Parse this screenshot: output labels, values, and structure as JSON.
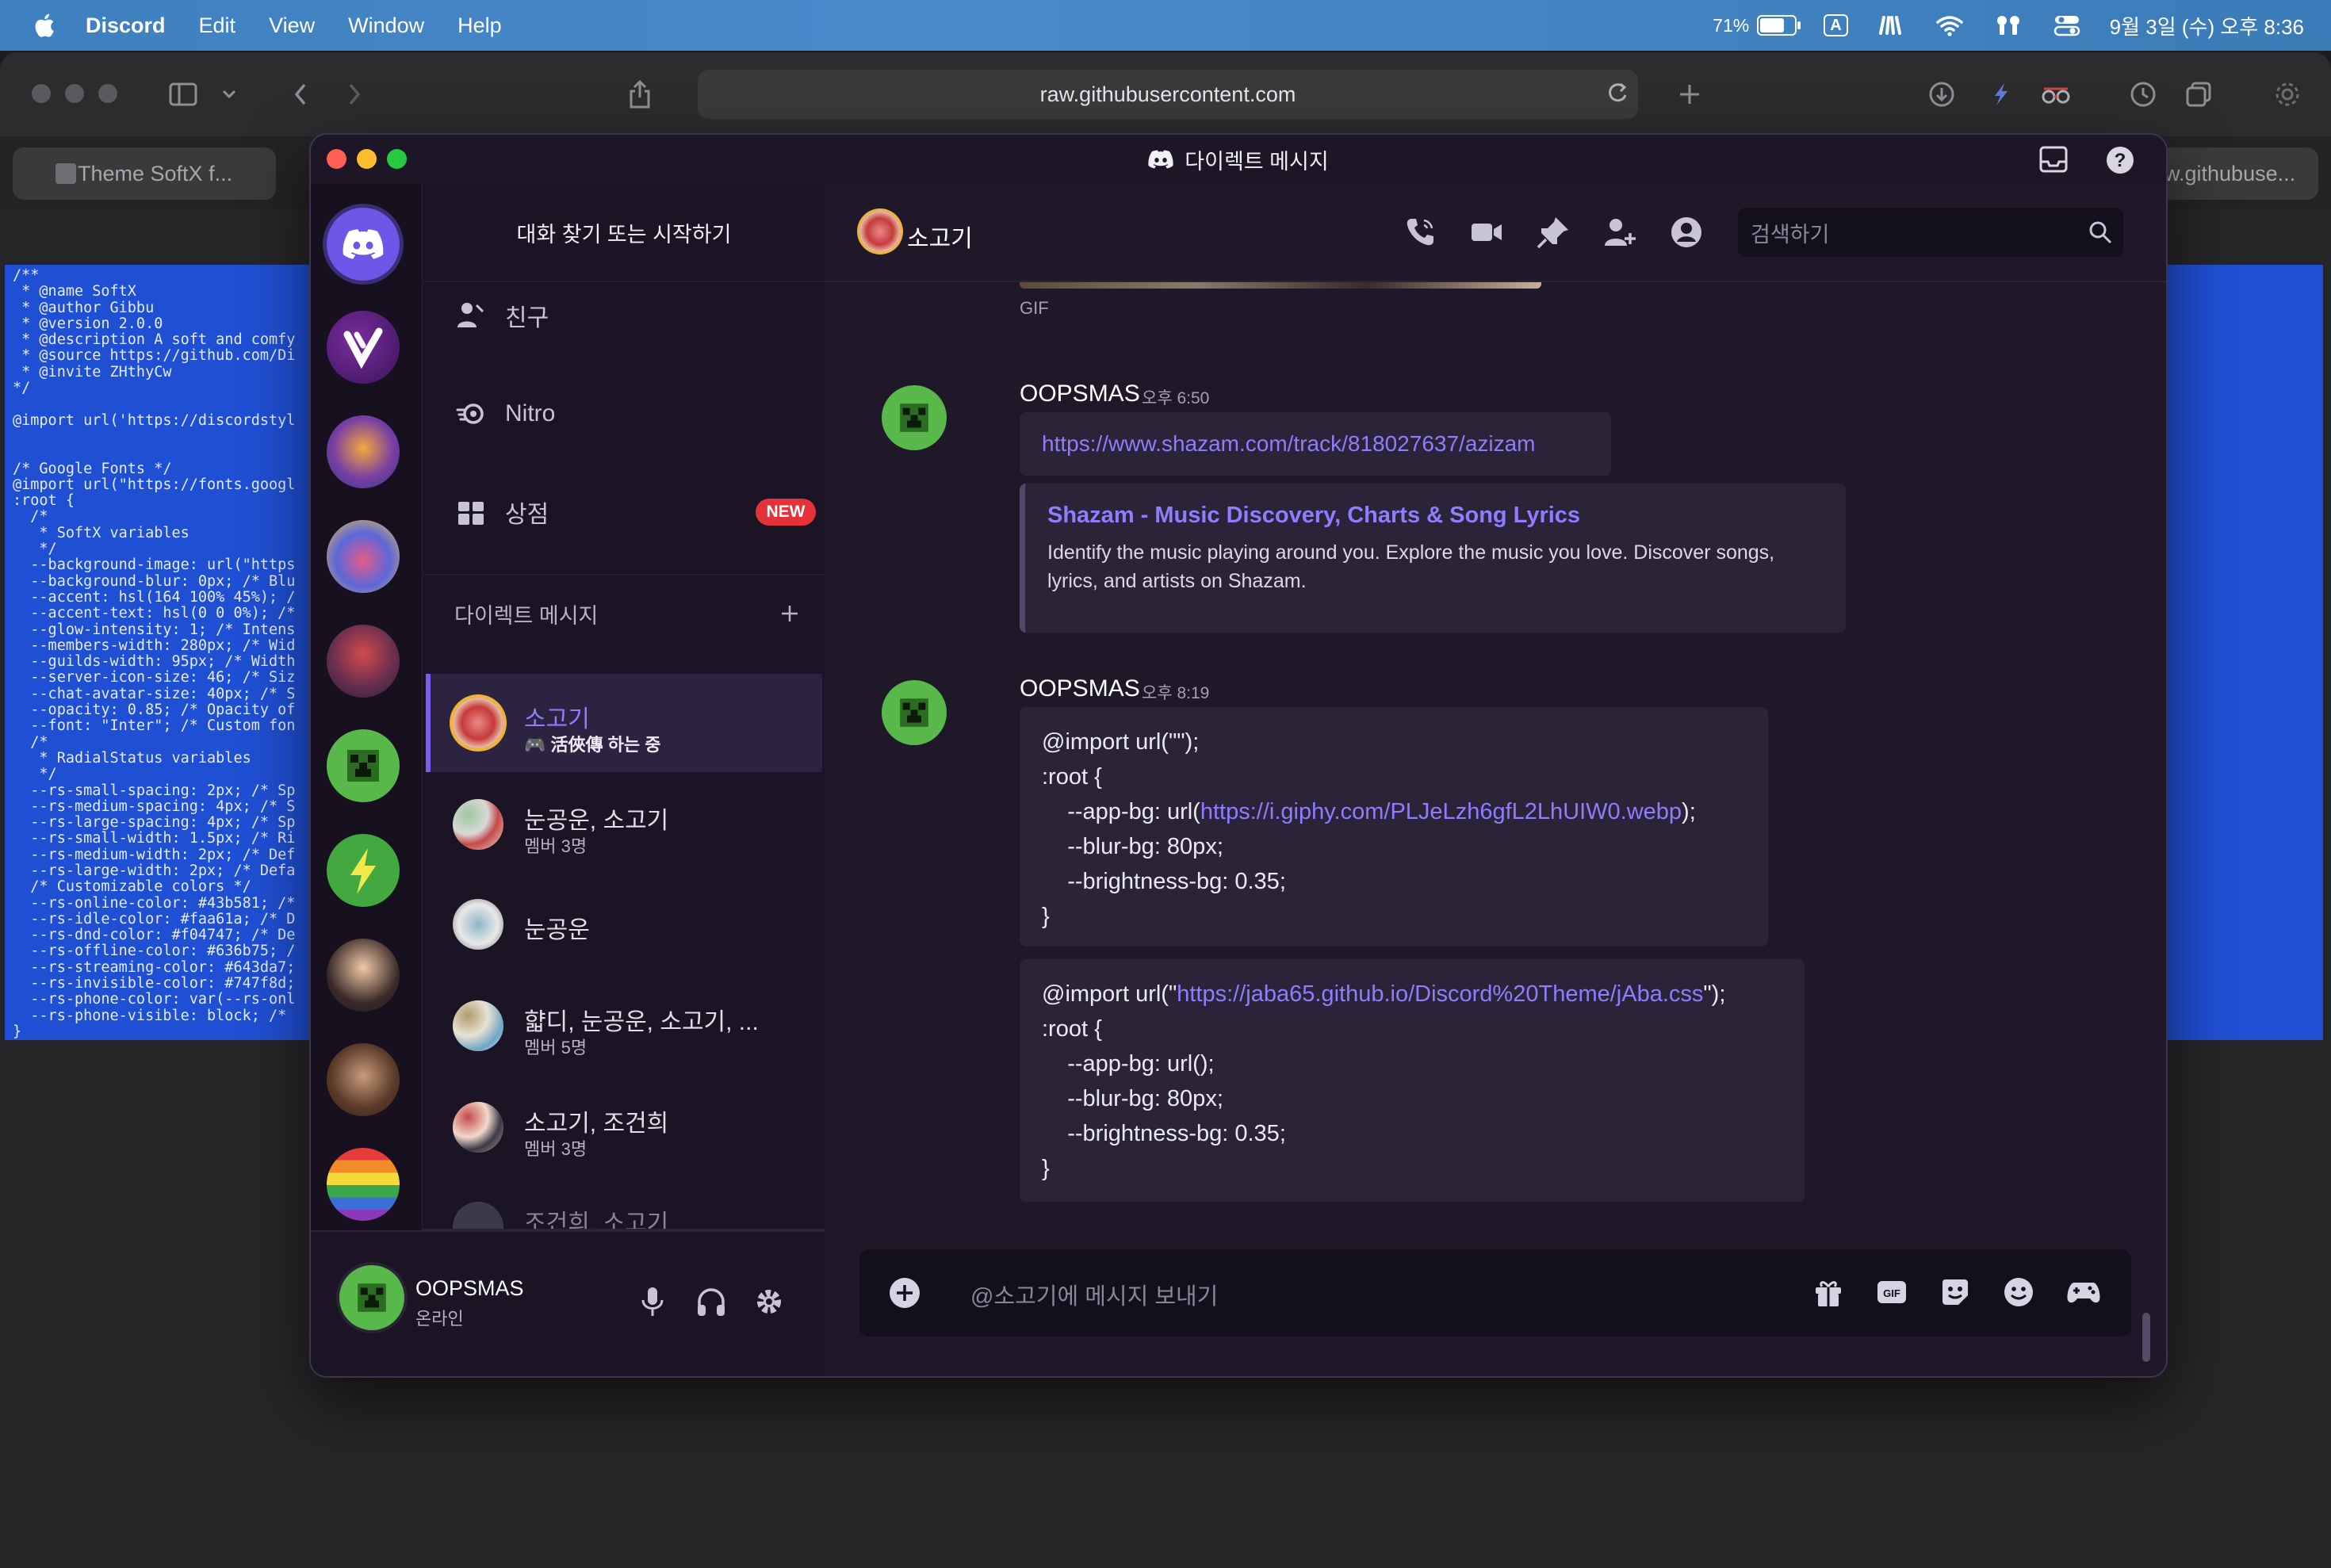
{
  "menubar": {
    "app_name": "Discord",
    "items": [
      "Edit",
      "View",
      "Window",
      "Help"
    ],
    "battery_pct": "71%",
    "battery_level": 0.71,
    "input_indicator": "A",
    "clock": "9월 3일 (수) 오후 8:36"
  },
  "safari": {
    "url": "raw.githubusercontent.com",
    "tab_left": "Theme SoftX f...",
    "tab_right": "w.githubuse...",
    "code_text": "/**\n * @name SoftX\n * @author Gibbu\n * @version 2.0.0\n * @description A soft and comfy\n * @source https://github.com/Di\n * @invite ZHthyCw\n*/\n\n@import url('https://discordstyl\n\n\n/* Google Fonts */\n@import url(\"https://fonts.googl\n:root {\n  /*\n   * SoftX variables\n   */\n  --background-image: url(\"https\n  --background-blur: 0px; /* Blu\n  --accent: hsl(164 100% 45%); /\n  --accent-text: hsl(0 0 0%); /*\n  --glow-intensity: 1; /* Intens\n  --members-width: 280px; /* Wid\n  --guilds-width: 95px; /* Width\n  --server-icon-size: 46; /* Siz\n  --chat-avatar-size: 40px; /* S\n  --opacity: 0.85; /* Opacity of\n  --font: \"Inter\"; /* Custom fon\n  /*\n   * RadialStatus variables\n   */\n  --rs-small-spacing: 2px; /* Sp\n  --rs-medium-spacing: 4px; /* S\n  --rs-large-spacing: 4px; /* Sp\n  --rs-small-width: 1.5px; /* Ri\n  --rs-medium-width: 2px; /* Def\n  --rs-large-width: 2px; /* Defa\n  /* Customizable colors */\n  --rs-online-color: #43b581; /*\n  --rs-idle-color: #faa61a; /* D\n  --rs-dnd-color: #f04747; /* De\n  --rs-offline-color: #636b75; /\n  --rs-streaming-color: #643da7;\n  --rs-invisible-color: #747f8d;\n  --rs-phone-color: var(--rs-onl\n  --rs-phone-visible: block; /* \n}"
  },
  "discord": {
    "window_title": "다이렉트 메시지",
    "sidebar": {
      "find_button": "대화 찾기 또는 시작하기",
      "nav": [
        {
          "label": "친구"
        },
        {
          "label": "Nitro"
        },
        {
          "label": "상점",
          "badge": "NEW"
        }
      ],
      "dm_header": "다이렉트 메시지",
      "dms": [
        {
          "name": "소고기",
          "sub": "活俠傳 하는 중"
        },
        {
          "name": "눈공운, 소고기",
          "sub": "멤버 3명"
        },
        {
          "name": "눈공운",
          "sub": ""
        },
        {
          "name": "햛디, 눈공운, 소고기, ...",
          "sub": "멤버 5명"
        },
        {
          "name": "소고기, 조건희",
          "sub": "멤버 3명"
        },
        {
          "name": "조건희, 소고기",
          "sub": ""
        }
      ]
    },
    "user": {
      "name": "OOPSMAS",
      "status": "온라인"
    },
    "chat": {
      "channel_name": "소고기",
      "search_placeholder": "검색하기",
      "gif_label": "GIF",
      "messages": [
        {
          "author": "OOPSMAS",
          "time": "오후 6:50",
          "link": "https://www.shazam.com/track/818027637/azizam",
          "embed_title": "Shazam - Music Discovery, Charts & Song Lyrics",
          "embed_desc": "Identify the music playing around you. Explore the music you love. Discover songs, lyrics, and artists on Shazam."
        },
        {
          "author": "OOPSMAS",
          "time": "오후 8:19",
          "code1": {
            "l1": "@import url(\"\");",
            "l2": ":root {",
            "l3_pre": "    --app-bg: url(",
            "l3_link": "https://i.giphy.com/PLJeLzh6gfL2LhUIW0.webp",
            "l3_post": ");",
            "l4": "    --blur-bg: 80px;",
            "l5": "    --brightness-bg: 0.35;",
            "l6": "}"
          },
          "code2": {
            "l1_pre": "@import url(\"",
            "l1_link": "https://jaba65.github.io/Discord%20Theme/jAba.css",
            "l1_post": "\");",
            "l2": ":root {",
            "l3": "    --app-bg: url();",
            "l4": "    --blur-bg: 80px;",
            "l5": "    --brightness-bg: 0.35;",
            "l6": "}"
          }
        }
      ],
      "composer_placeholder": "@소고기에 메시지 보내기"
    },
    "colors": {
      "accent": "#7b5cf0",
      "link": "#8f7cff",
      "new_badge": "#e5323a"
    }
  }
}
